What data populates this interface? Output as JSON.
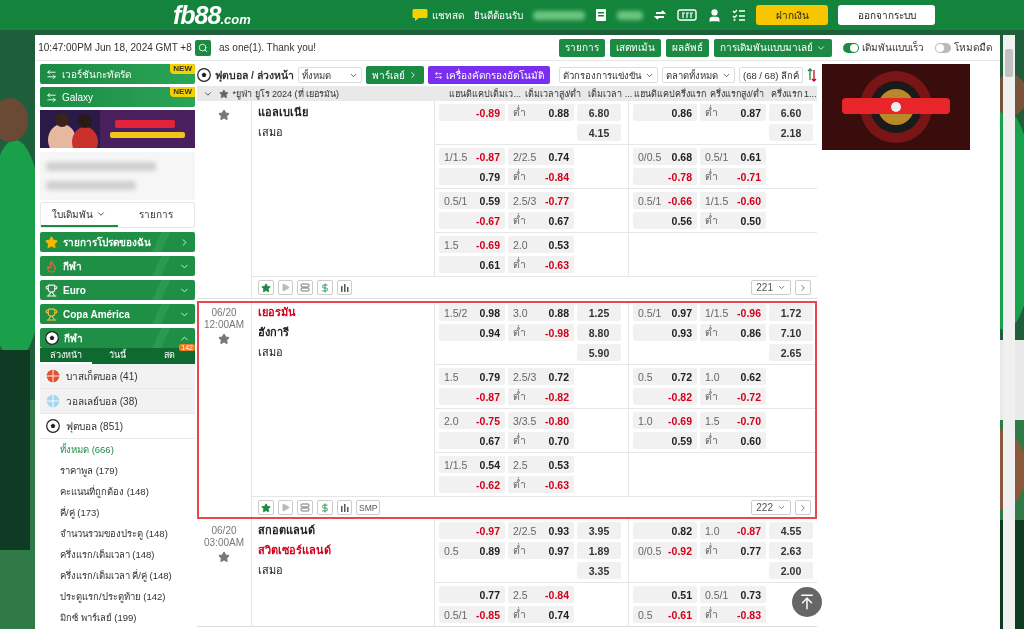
{
  "header": {
    "logo": {
      "name": "fb88",
      "domain": ".com"
    },
    "chat_label": "แชทสด",
    "welcome": "ยินดีต้อนรับ",
    "buttons": [
      {
        "label": "ฝากเงิน",
        "kind": "primary"
      },
      {
        "label": "ออกจากระบบ",
        "kind": "secondary"
      }
    ]
  },
  "top_bar": {
    "clock": "10:47:00PM Jun 18, 2024 GMT +8",
    "announcement": "as one(1). Thank you!",
    "links": [
      "รายการ",
      "เสตทเม้น",
      "ผลลัพธ์"
    ],
    "odds_type": "การเดิมพันแบบมาเลย์",
    "toggles": [
      {
        "label": "เดิมพันแบบเร็ว",
        "on": true
      },
      {
        "label": "โหมดมืด",
        "on": false
      }
    ]
  },
  "sidebar": {
    "version_buttons": [
      {
        "label": "เวอร์ชันกะทัดรัด",
        "badge": "NEW"
      },
      {
        "label": "Galaxy",
        "badge": "NEW"
      }
    ],
    "tabs": [
      {
        "label": "ใบเดิมพัน",
        "selected": true,
        "dropdown": true
      },
      {
        "label": "รายการ",
        "selected": false,
        "dropdown": false
      }
    ],
    "sections": [
      {
        "label": "รายการโปรดของฉัน",
        "kind": "favorites"
      },
      {
        "label": "กีฬา",
        "kind": "torch",
        "expanded": false
      },
      {
        "label": "Euro",
        "kind": "trophy",
        "expanded": false
      },
      {
        "label": "Copa América",
        "kind": "medal",
        "expanded": false
      },
      {
        "label": "กีฬา",
        "kind": "ball",
        "expanded": true
      }
    ],
    "period_tabs": [
      {
        "label": "ล่วงหน้า",
        "selected": true
      },
      {
        "label": "วันนี้",
        "selected": false
      },
      {
        "label": "สด",
        "selected": false,
        "badge": "142"
      }
    ],
    "sports": [
      {
        "name": "บาสเก็ตบอล (41)",
        "kind": "basketball",
        "expanded": false
      },
      {
        "name": "วอลเลย์บอล (38)",
        "kind": "volleyball",
        "expanded": false
      },
      {
        "name": "ฟุตบอล (851)",
        "kind": "football",
        "expanded": true,
        "children": [
          {
            "label": "ทั้งหมด (666)",
            "selected": true
          },
          {
            "label": "ราคาพูล (179)",
            "selected": false
          },
          {
            "label": "คะแนนที่ถูกต้อง (148)",
            "selected": false
          },
          {
            "label": "คี่/คู่ (173)",
            "selected": false
          },
          {
            "label": "จำนวนรวมของประตู (148)",
            "selected": false
          },
          {
            "label": "ครึ่งแรก/เต็มเวลา (148)",
            "selected": false
          },
          {
            "label": "ครึ่งแรก/เต็มเวลา คี่/คู่ (148)",
            "selected": false
          },
          {
            "label": "ประตูแรก/ประตูท้าย (142)",
            "selected": false
          },
          {
            "label": "มิกซ์ พาร์เลย์ (199)",
            "selected": false
          }
        ]
      }
    ]
  },
  "filter_bar": {
    "title": "ฟุตบอล / ล่วงหน้า",
    "market_select": "ทั้งหมด",
    "parlay_button": "พาร์เลย์",
    "auto_filter_button": "เครื่องคัดกรองอัตโนมัติ",
    "filters": [
      "ตัวกรองการแข่งขัน",
      "ตลาดทั้งหมด"
    ],
    "league_count": "(68 / 68) ลีกค์"
  },
  "league": {
    "title": "*ยูฟ่า ยูโร 2024 (ที่ เยอรมัน)",
    "columns": [
      "แฮนดิแคปเต็มเว...",
      "เต็มเวลาสูง/ต่ำ",
      "เต็มเวลา ...",
      "แฮนดิแคปครึ่งแรก",
      "ครึ่งแรกสูง/ต่ำ",
      "ครึ่งแรก 1..."
    ]
  },
  "matches": [
    {
      "selected": false,
      "teams": [
        {
          "name": "แอลเบเนีย",
          "kind": "team",
          "favorite": false
        },
        {
          "name": "เสมอ",
          "kind": "draw",
          "favorite": false
        }
      ],
      "blocks": [
        {
          "ft_hdp": [
            {
              "odds": "-0.89",
              "negative": true
            }
          ],
          "ft_ou": [
            {
              "line": "ต่ำ",
              "odds": "0.88",
              "negative": false
            }
          ],
          "ft_1x2": [
            "6.80",
            "4.15"
          ],
          "h1_hdp": [
            {
              "odds": "0.86",
              "negative": false
            }
          ],
          "h1_ou": [
            {
              "line": "ต่ำ",
              "odds": "0.87",
              "negative": false
            }
          ],
          "h1_1x2": [
            "6.60",
            "2.18"
          ]
        },
        {
          "ft_hdp": [
            {
              "line": "1/1.5",
              "odds": "-0.87",
              "negative": true
            },
            {
              "odds": "0.79",
              "negative": false
            }
          ],
          "ft_ou": [
            {
              "line": "2/2.5",
              "odds": "0.74",
              "negative": false
            },
            {
              "line": "ต่ำ",
              "odds": "-0.84",
              "negative": true
            }
          ],
          "h1_hdp": [
            {
              "line": "0/0.5",
              "odds": "0.68",
              "negative": false
            },
            {
              "odds": "-0.78",
              "negative": true
            }
          ],
          "h1_ou": [
            {
              "line": "0.5/1",
              "odds": "0.61",
              "negative": false
            },
            {
              "line": "ต่ำ",
              "odds": "-0.71",
              "negative": true
            }
          ]
        },
        {
          "ft_hdp": [
            {
              "line": "0.5/1",
              "odds": "0.59",
              "negative": false
            },
            {
              "odds": "-0.67",
              "negative": true
            }
          ],
          "ft_ou": [
            {
              "line": "2.5/3",
              "odds": "-0.77",
              "negative": true
            },
            {
              "line": "ต่ำ",
              "odds": "0.67",
              "negative": false
            }
          ],
          "h1_hdp": [
            {
              "line": "0.5/1",
              "odds": "-0.66",
              "negative": true
            },
            {
              "odds": "0.56",
              "negative": false
            }
          ],
          "h1_ou": [
            {
              "line": "1/1.5",
              "odds": "-0.60",
              "negative": true
            },
            {
              "line": "ต่ำ",
              "odds": "0.50",
              "negative": false
            }
          ]
        },
        {
          "ft_hdp": [
            {
              "line": "1.5",
              "odds": "-0.69",
              "negative": true
            },
            {
              "odds": "0.61",
              "negative": false
            }
          ],
          "ft_ou": [
            {
              "line": "2.0",
              "odds": "0.53",
              "negative": false
            },
            {
              "line": "ต่ำ",
              "odds": "-0.63",
              "negative": true
            }
          ]
        }
      ],
      "footer": {
        "count": "221"
      }
    },
    {
      "date": "06/20",
      "time": "12:00AM",
      "selected": true,
      "teams": [
        {
          "name": "เยอรมัน",
          "kind": "team",
          "favorite": true
        },
        {
          "name": "ฮังการี",
          "kind": "team",
          "favorite": false
        },
        {
          "name": "เสมอ",
          "kind": "draw",
          "favorite": false
        }
      ],
      "blocks": [
        {
          "ft_hdp": [
            {
              "line": "1.5/2",
              "odds": "0.98",
              "negative": false
            },
            {
              "odds": "0.94",
              "negative": false
            }
          ],
          "ft_ou": [
            {
              "line": "3.0",
              "odds": "0.88",
              "negative": false
            },
            {
              "line": "ต่ำ",
              "odds": "-0.98",
              "negative": true
            }
          ],
          "ft_1x2": [
            "1.25",
            "8.80",
            "5.90"
          ],
          "h1_hdp": [
            {
              "line": "0.5/1",
              "odds": "0.97",
              "negative": false
            },
            {
              "odds": "0.93",
              "negative": false
            }
          ],
          "h1_ou": [
            {
              "line": "1/1.5",
              "odds": "-0.96",
              "negative": true
            },
            {
              "line": "ต่ำ",
              "odds": "0.86",
              "negative": false
            }
          ],
          "h1_1x2": [
            "1.72",
            "7.10",
            "2.65"
          ]
        },
        {
          "ft_hdp": [
            {
              "line": "1.5",
              "odds": "0.79",
              "negative": false
            },
            {
              "odds": "-0.87",
              "negative": true
            }
          ],
          "ft_ou": [
            {
              "line": "2.5/3",
              "odds": "0.72",
              "negative": false
            },
            {
              "line": "ต่ำ",
              "odds": "-0.82",
              "negative": true
            }
          ],
          "h1_hdp": [
            {
              "line": "0.5",
              "odds": "0.72",
              "negative": false
            },
            {
              "odds": "-0.82",
              "negative": true
            }
          ],
          "h1_ou": [
            {
              "line": "1.0",
              "odds": "0.62",
              "negative": false
            },
            {
              "line": "ต่ำ",
              "odds": "-0.72",
              "negative": true
            }
          ]
        },
        {
          "ft_hdp": [
            {
              "line": "2.0",
              "odds": "-0.75",
              "negative": true
            },
            {
              "odds": "0.67",
              "negative": false
            }
          ],
          "ft_ou": [
            {
              "line": "3/3.5",
              "odds": "-0.80",
              "negative": true
            },
            {
              "line": "ต่ำ",
              "odds": "0.70",
              "negative": false
            }
          ],
          "h1_hdp": [
            {
              "line": "1.0",
              "odds": "-0.69",
              "negative": true
            },
            {
              "odds": "0.59",
              "negative": false
            }
          ],
          "h1_ou": [
            {
              "line": "1.5",
              "odds": "-0.70",
              "negative": true
            },
            {
              "line": "ต่ำ",
              "odds": "0.60",
              "negative": false
            }
          ]
        },
        {
          "ft_hdp": [
            {
              "line": "1/1.5",
              "odds": "0.54",
              "negative": false
            },
            {
              "odds": "-0.62",
              "negative": true
            }
          ],
          "ft_ou": [
            {
              "line": "2.5",
              "odds": "0.53",
              "negative": false
            },
            {
              "line": "ต่ำ",
              "odds": "-0.63",
              "negative": true
            }
          ]
        }
      ],
      "footer": {
        "count": "222",
        "smp": "SMP"
      }
    },
    {
      "date": "06/20",
      "time": "03:00AM",
      "selected": false,
      "teams": [
        {
          "name": "สกอตแลนด์",
          "kind": "team",
          "favorite": false
        },
        {
          "name": "สวิตเซอร์แลนด์",
          "kind": "team",
          "favorite": true
        },
        {
          "name": "เสมอ",
          "kind": "draw",
          "favorite": false
        }
      ],
      "blocks": [
        {
          "ft_hdp": [
            {
              "odds": "-0.97",
              "negative": true
            },
            {
              "line": "0.5",
              "odds": "0.89",
              "negative": false
            }
          ],
          "ft_ou": [
            {
              "line": "2/2.5",
              "odds": "0.93",
              "negative": false
            },
            {
              "line": "ต่ำ",
              "odds": "0.97",
              "negative": false
            }
          ],
          "ft_1x2": [
            "3.95",
            "1.89",
            "3.35"
          ],
          "h1_hdp": [
            {
              "odds": "0.82",
              "negative": false
            },
            {
              "line": "0/0.5",
              "odds": "-0.92",
              "negative": true
            }
          ],
          "h1_ou": [
            {
              "line": "1.0",
              "odds": "-0.87",
              "negative": true
            },
            {
              "line": "ต่ำ",
              "odds": "0.77",
              "negative": false
            }
          ],
          "h1_1x2": [
            "4.55",
            "2.63",
            "2.00"
          ]
        },
        {
          "ft_hdp": [
            {
              "odds": "0.77",
              "negative": false
            },
            {
              "line": "0.5/1",
              "odds": "-0.85",
              "negative": true
            }
          ],
          "ft_ou": [
            {
              "line": "2.5",
              "odds": "-0.84",
              "negative": true
            },
            {
              "line": "ต่ำ",
              "odds": "0.74",
              "negative": false
            }
          ],
          "h1_hdp": [
            {
              "odds": "0.51",
              "negative": false
            },
            {
              "line": "0.5",
              "odds": "-0.61",
              "negative": true
            }
          ],
          "h1_ou": [
            {
              "line": "0.5/1",
              "odds": "0.73",
              "negative": false
            },
            {
              "line": "ต่ำ",
              "odds": "-0.83",
              "negative": true
            }
          ]
        }
      ]
    }
  ]
}
